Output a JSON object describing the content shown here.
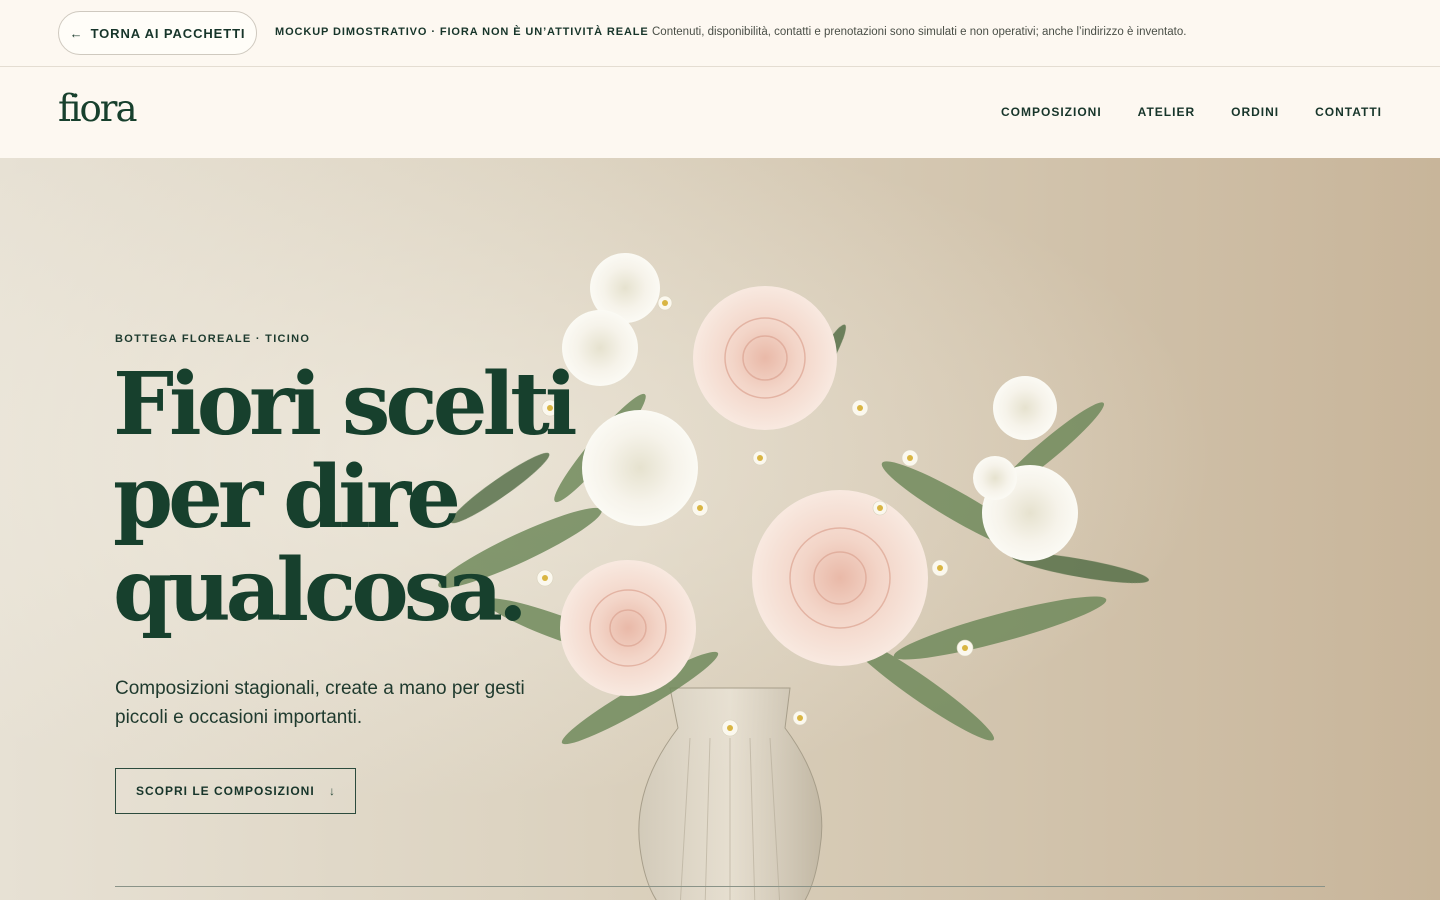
{
  "notice": {
    "back_label": "TORNA AI PACCHETTI",
    "back_icon": "arrow-left-icon",
    "title": "MOCKUP DIMOSTRATIVO · FIORA NON È UN’ATTIVITÀ REALE",
    "text": "Contenuti, disponibilità, contatti e prenotazioni sono simulati e non operativi; anche l’indirizzo è inventato."
  },
  "header": {
    "logo": "fiora",
    "nav": [
      "COMPOSIZIONI",
      "ATELIER",
      "ORDINI",
      "CONTATTI"
    ]
  },
  "hero": {
    "eyebrow": "BOTTEGA FLOREALE · TICINO",
    "headline_lines": [
      "Fiori scelti",
      "per dire",
      "qualcosa."
    ],
    "subtitle": "Composizioni stagionali, create a mano per gesti piccoli e occasioni importanti.",
    "cta_label": "SCOPRI LE COMPOSIZIONI",
    "cta_icon": "arrow-down-icon",
    "image": "bouquet-of-roses-ranunculus-chamomile-in-glass-vase"
  },
  "colors": {
    "brand_green": "#17402d",
    "background": "#fdf8f1"
  }
}
